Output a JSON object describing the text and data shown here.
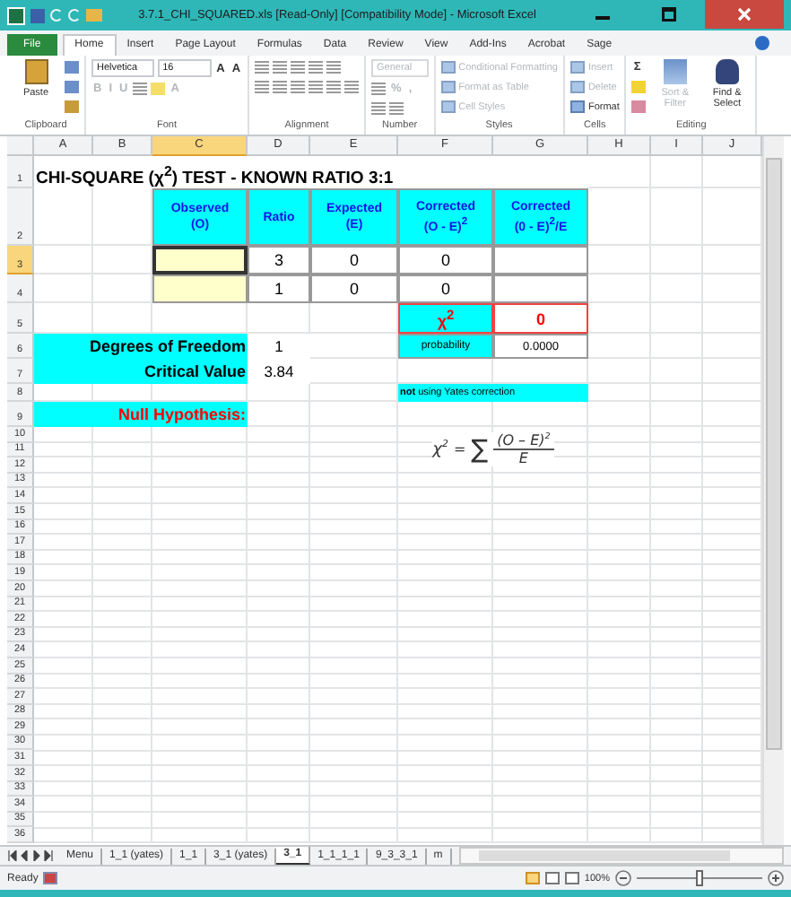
{
  "window": {
    "title": "3.7.1_CHI_SQUARED.xls  [Read-Only]  [Compatibility Mode]  -  Microsoft Excel"
  },
  "ribbon_tabs": [
    {
      "label": "File",
      "kind": "file",
      "selected": false
    },
    {
      "label": "Home",
      "kind": "tab",
      "selected": true
    },
    {
      "label": "Insert",
      "kind": "tab",
      "selected": false
    },
    {
      "label": "Page Layout",
      "kind": "tab",
      "selected": false
    },
    {
      "label": "Formulas",
      "kind": "tab",
      "selected": false
    },
    {
      "label": "Data",
      "kind": "tab",
      "selected": false
    },
    {
      "label": "Review",
      "kind": "tab",
      "selected": false
    },
    {
      "label": "View",
      "kind": "tab",
      "selected": false
    },
    {
      "label": "Add-Ins",
      "kind": "tab",
      "selected": false
    },
    {
      "label": "Acrobat",
      "kind": "tab",
      "selected": false
    },
    {
      "label": "Sage",
      "kind": "tab",
      "selected": false
    }
  ],
  "ribbon_groups": [
    {
      "label": "Clipboard",
      "columns": [
        [
          [
            {
              "kind": "big",
              "text": "Paste",
              "disabled": false
            }
          ]
        ],
        [
          [
            {
              "kind": "icon",
              "disabled": false
            }
          ],
          [
            {
              "kind": "icon",
              "disabled": false
            }
          ],
          [
            {
              "kind": "icon",
              "disabled": false
            }
          ]
        ]
      ]
    },
    {
      "label": "Font",
      "columns": [
        [
          [
            {
              "kind": "dropdown",
              "text": "Helvetica",
              "disabled": false
            },
            {
              "kind": "dropdown",
              "text": "16",
              "disabled": false
            },
            {
              "kind": "glyph",
              "text": "A",
              "disabled": false
            },
            {
              "kind": "glyph",
              "text": "A",
              "disabled": false
            }
          ],
          [
            {
              "kind": "glyph",
              "text": "B",
              "disabled": true
            },
            {
              "kind": "glyph",
              "text": "I",
              "disabled": true
            },
            {
              "kind": "glyph",
              "text": "U",
              "disabled": true
            },
            {
              "kind": "icon",
              "disabled": true
            },
            {
              "kind": "icon",
              "disabled": true
            },
            {
              "kind": "glyph",
              "text": "A",
              "disabled": true
            }
          ]
        ]
      ]
    },
    {
      "label": "Alignment",
      "columns": [
        [
          [
            {
              "kind": "icon",
              "disabled": true
            },
            {
              "kind": "icon",
              "disabled": true
            },
            {
              "kind": "icon",
              "disabled": true
            },
            {
              "kind": "icon",
              "disabled": true
            },
            {
              "kind": "icon",
              "disabled": true
            }
          ],
          [
            {
              "kind": "icon",
              "disabled": true
            },
            {
              "kind": "icon",
              "disabled": true
            },
            {
              "kind": "icon",
              "disabled": true
            },
            {
              "kind": "icon",
              "disabled": true
            },
            {
              "kind": "icon",
              "disabled": true
            },
            {
              "kind": "icon",
              "disabled": true
            }
          ]
        ]
      ]
    },
    {
      "label": "Number",
      "columns": [
        [
          [
            {
              "kind": "dropdown",
              "text": "General",
              "disabled": true
            }
          ],
          [
            {
              "kind": "icon",
              "disabled": true
            },
            {
              "kind": "glyph",
              "text": "%",
              "disabled": true
            },
            {
              "kind": "glyph",
              "text": ",",
              "disabled": true
            }
          ],
          [
            {
              "kind": "icon",
              "disabled": true
            },
            {
              "kind": "icon",
              "disabled": true
            }
          ]
        ]
      ]
    },
    {
      "label": "Styles",
      "columns": [
        [
          [
            {
              "kind": "small",
              "text": "Conditional Formatting",
              "disabled": true
            }
          ],
          [
            {
              "kind": "small",
              "text": "Format as Table",
              "disabled": true
            }
          ],
          [
            {
              "kind": "small",
              "text": "Cell Styles",
              "disabled": true
            }
          ]
        ]
      ]
    },
    {
      "label": "Cells",
      "columns": [
        [
          [
            {
              "kind": "small",
              "text": "Insert",
              "disabled": true
            }
          ],
          [
            {
              "kind": "small",
              "text": "Delete",
              "disabled": true
            }
          ],
          [
            {
              "kind": "small",
              "text": "Format",
              "disabled": false
            }
          ]
        ]
      ]
    },
    {
      "label": "Editing",
      "columns": [
        [
          [
            {
              "kind": "glyph",
              "text": "Σ",
              "disabled": false
            }
          ],
          [
            {
              "kind": "icon",
              "disabled": false
            }
          ],
          [
            {
              "kind": "icon",
              "disabled": false
            }
          ]
        ],
        [
          [
            {
              "kind": "big",
              "text": "Sort & Filter",
              "disabled": true
            }
          ]
        ],
        [
          [
            {
              "kind": "big",
              "text": "Find & Select",
              "disabled": false
            }
          ]
        ]
      ]
    }
  ],
  "sheet": {
    "columns": [
      {
        "label": "A",
        "selected": false
      },
      {
        "label": "B",
        "selected": false
      },
      {
        "label": "C",
        "selected": true
      },
      {
        "label": "D",
        "selected": false
      },
      {
        "label": "E",
        "selected": false
      },
      {
        "label": "F",
        "selected": false
      },
      {
        "label": "G",
        "selected": false
      },
      {
        "label": "H",
        "selected": false
      },
      {
        "label": "I",
        "selected": false
      },
      {
        "label": "J",
        "selected": false
      }
    ],
    "rows": [
      {
        "label": "1",
        "selected": false
      },
      {
        "label": "2",
        "selected": false
      },
      {
        "label": "3",
        "selected": true
      },
      {
        "label": "4",
        "selected": false
      },
      {
        "label": "5",
        "selected": false
      },
      {
        "label": "6",
        "selected": false
      },
      {
        "label": "7",
        "selected": false
      },
      {
        "label": "8",
        "selected": false
      },
      {
        "label": "9",
        "selected": false
      },
      {
        "label": "10",
        "selected": false
      },
      {
        "label": "11",
        "selected": false
      },
      {
        "label": "12",
        "selected": false
      },
      {
        "label": "13",
        "selected": false
      },
      {
        "label": "14",
        "selected": false
      },
      {
        "label": "15",
        "selected": false
      },
      {
        "label": "16",
        "selected": false
      },
      {
        "label": "17",
        "selected": false
      },
      {
        "label": "18",
        "selected": false
      },
      {
        "label": "19",
        "selected": false
      },
      {
        "label": "20",
        "selected": false
      },
      {
        "label": "21",
        "selected": false
      },
      {
        "label": "22",
        "selected": false
      },
      {
        "label": "23",
        "selected": false
      },
      {
        "label": "24",
        "selected": false
      },
      {
        "label": "25",
        "selected": false
      },
      {
        "label": "26",
        "selected": false
      },
      {
        "label": "27",
        "selected": false
      },
      {
        "label": "28",
        "selected": false
      },
      {
        "label": "29",
        "selected": false
      },
      {
        "label": "30",
        "selected": false
      },
      {
        "label": "31",
        "selected": false
      },
      {
        "label": "32",
        "selected": false
      },
      {
        "label": "33",
        "selected": false
      },
      {
        "label": "34",
        "selected": false
      },
      {
        "label": "35",
        "selected": false
      },
      {
        "label": "36",
        "selected": false
      }
    ],
    "cells": [
      {
        "kind": "title",
        "text": "CHI-SQUARE (χ$^{2}$) TEST - KNOWN RATIO 3:1",
        "selected": false
      },
      {
        "kind": "header",
        "text": "Observed\n(O)",
        "selected": false
      },
      {
        "kind": "header",
        "text": "Ratio",
        "selected": false
      },
      {
        "kind": "header",
        "text": "Expected\n(E)",
        "selected": false
      },
      {
        "kind": "header",
        "text": "Corrected\n(O - E)$^{2}$",
        "selected": false
      },
      {
        "kind": "header",
        "text": "Corrected\n(0 - E)$^{2}$/E",
        "selected": false
      },
      {
        "kind": "input",
        "selected": true
      },
      {
        "kind": "value",
        "text": "3",
        "selected": false
      },
      {
        "kind": "value",
        "text": "0",
        "selected": false
      },
      {
        "kind": "value",
        "text": "0",
        "selected": false
      },
      {
        "kind": "value",
        "selected": false
      },
      {
        "kind": "input",
        "selected": false
      },
      {
        "kind": "value",
        "text": "1",
        "selected": false
      },
      {
        "kind": "value",
        "text": "0",
        "selected": false
      },
      {
        "kind": "value",
        "text": "0",
        "selected": false
      },
      {
        "kind": "value",
        "selected": false
      },
      {
        "kind": "chi",
        "text": "χ$^{2}$",
        "selected": false
      },
      {
        "kind": "result",
        "text": "0",
        "selected": false
      },
      {
        "kind": "label",
        "text": "Degrees of Freedom",
        "selected": false
      },
      {
        "kind": "plain",
        "text": "1",
        "selected": false
      },
      {
        "kind": "small_header",
        "text": "probability",
        "selected": false
      },
      {
        "kind": "small_value",
        "text": "0.0000",
        "selected": false
      },
      {
        "kind": "label",
        "text": "Critical Value",
        "selected": false
      },
      {
        "kind": "plain",
        "text": "3.84",
        "selected": false
      },
      {
        "kind": "note",
        "text": "**not** using Yates correction",
        "selected": false
      },
      {
        "kind": "red_label",
        "text": "Null Hypothesis:",
        "selected": false
      }
    ],
    "equation": {
      "lhs": "χ",
      "lhs_power": "2",
      "equals": "=",
      "sigma": "∑",
      "numerator": "(O – E)",
      "numerator_power": "2",
      "denominator": "E"
    }
  },
  "sheet_tabs": [
    {
      "label": "Menu",
      "selected": false
    },
    {
      "label": "1_1 (yates)",
      "selected": false
    },
    {
      "label": "1_1",
      "selected": false
    },
    {
      "label": "3_1 (yates)",
      "selected": false
    },
    {
      "label": "3_1",
      "selected": true
    },
    {
      "label": "1_1_1_1",
      "selected": false
    },
    {
      "label": "9_3_3_1",
      "selected": false
    },
    {
      "label": "m",
      "selected": false
    }
  ],
  "status_bar": {
    "status": "Ready",
    "zoom": "100%",
    "zoom_slider": {
      "level": 0.5
    }
  }
}
